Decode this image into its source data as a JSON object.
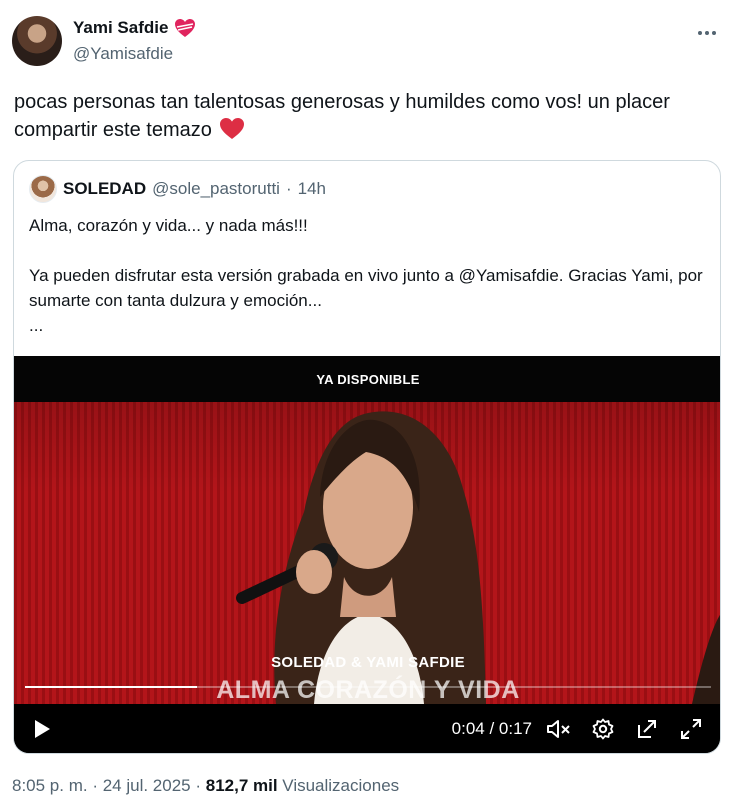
{
  "author": {
    "name": "Yami Safdie",
    "handle": "@Yamisafdie",
    "badge_icon": "heart-ribbon-icon"
  },
  "tweet": {
    "text": "pocas personas tan talentosas generosas y humildes como vos! un placer compartir este temazo",
    "emoji": "red-heart-icon"
  },
  "quoted": {
    "name": "SOLEDAD",
    "handle": "@sole_pastorutti",
    "separator": "·",
    "time": "14h",
    "text": "Alma, corazón y vida... y nada más!!!\n\nYa pueden disfrutar esta versión grabada en vivo junto a @Yamisafdie. Gracias Yami, por sumarte con tanta dulzura y emoción...\n..."
  },
  "video": {
    "banner": "YA DISPONIBLE",
    "caption_artists": "SOLEDAD & YAMI SAFDIE",
    "caption_title": "ALMA CORAZÓN Y VIDA",
    "time_display": "0:04 / 0:17",
    "progress": 0.25,
    "accent_color": "#b3151a"
  },
  "meta": {
    "time": "8:05 p. m.",
    "sep1": " · ",
    "date": "24 jul. 2025",
    "sep2": " · ",
    "views_count": "812,7 mil",
    "views_label": " Visualizaciones"
  }
}
